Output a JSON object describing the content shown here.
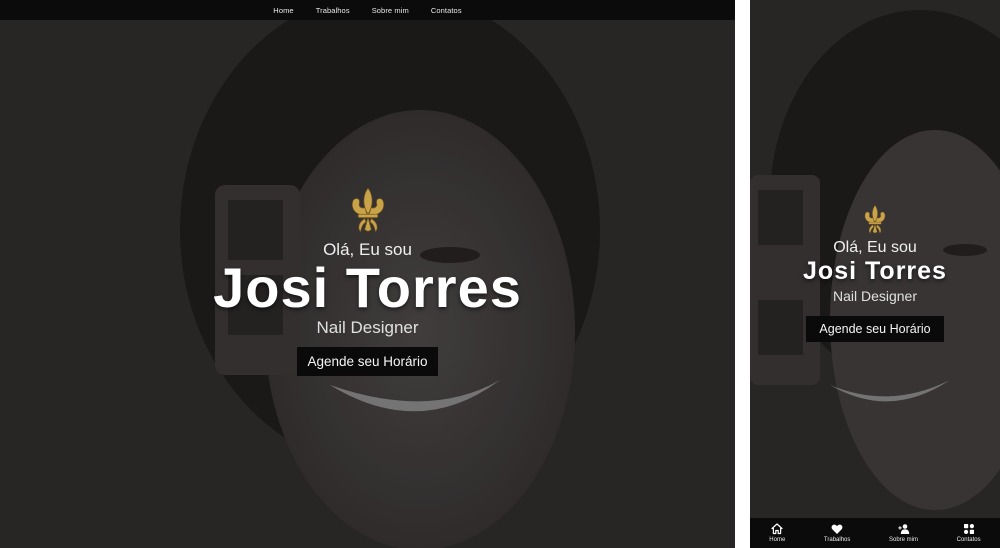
{
  "nav": {
    "home": "Home",
    "works": "Trabalhos",
    "about": "Sobre mim",
    "contact": "Contatos"
  },
  "hero": {
    "greeting": "Olá, Eu sou",
    "name": "Josi Torres",
    "role": "Nail Designer",
    "cta": "Agende seu Horário"
  },
  "colors": {
    "nav_bg": "#0b0b0b",
    "overlay_bg": "#2f2c2c",
    "button_bg": "#0a0a0a",
    "emblem_gold": "#c9a34a"
  },
  "icons": {
    "emblem": "fleur-de-lis-icon",
    "home": "home-icon",
    "works": "heart-icon",
    "about": "user-add-icon",
    "contact": "contact-icon"
  }
}
